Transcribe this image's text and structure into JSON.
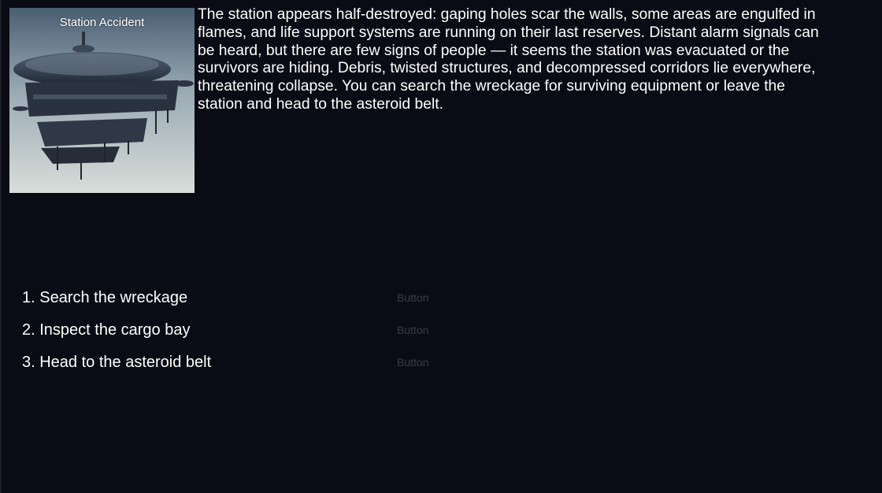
{
  "scene": {
    "title": "Station Accident",
    "image_icon": "damaged-space-station-illustration",
    "description": "The station appears half-destroyed: gaping holes scar the walls, some areas are engulfed in flames, and life support systems are running on their last reserves. Distant alarm signals can be heard, but there are few signs of people — it seems the station was evacuated or the survivors are hiding. Debris, twisted structures, and decompressed corridors lie everywhere, threatening collapse. You can search the wreckage for surviving equipment or leave the station and head to the asteroid belt."
  },
  "choices": [
    {
      "label": "1. Search the wreckage",
      "button": "Button"
    },
    {
      "label": "2. Inspect the cargo bay",
      "button": "Button"
    },
    {
      "label": "3. Head to the asteroid belt",
      "button": "Button"
    }
  ],
  "colors": {
    "background": "#0a0b14",
    "text": "#ffffff",
    "button_text": "#3a3c48"
  }
}
